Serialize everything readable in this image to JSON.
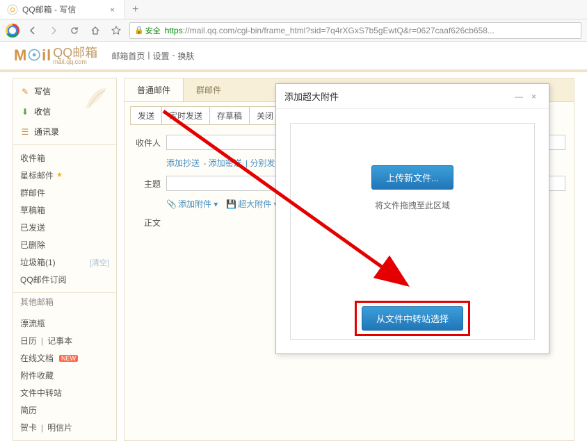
{
  "browser": {
    "tab_title": "QQ邮箱 - 写信",
    "secure_label": "安全",
    "url_https": "https",
    "url_rest": "://mail.qq.com/cgi-bin/frame_html?sid=7q4rXGxS7b5gEwtQ&r=0627caaf626cb658..."
  },
  "header": {
    "logo_m": "M",
    "logo_o": "☉",
    "logo_il": "il",
    "logo_cn": "QQ邮箱",
    "logo_url": "mail.qq.com",
    "links": {
      "home": "邮箱首页",
      "settings": "设置",
      "skin": "换肤"
    }
  },
  "sidebar": {
    "compose": [
      {
        "icon": "✎",
        "label": "写信"
      },
      {
        "icon": "⬇",
        "label": "收信"
      },
      {
        "icon": "☰",
        "label": "通讯录"
      }
    ],
    "folders": [
      {
        "label": "收件箱"
      },
      {
        "label": "星标邮件",
        "star": true
      },
      {
        "label": "群邮件"
      },
      {
        "label": "草稿箱"
      },
      {
        "label": "已发送"
      },
      {
        "label": "已删除"
      },
      {
        "label": "垃圾箱(1)",
        "clear": "[清空]"
      },
      {
        "label": "QQ邮件订阅"
      }
    ],
    "others_head": "其他邮箱",
    "others": [
      {
        "label": "漂流瓶"
      },
      {
        "label": "日历",
        "sep": "记事本"
      },
      {
        "label": "在线文档",
        "badge": "NEW"
      },
      {
        "label": "附件收藏"
      },
      {
        "label": "文件中转站"
      },
      {
        "label": "简历"
      },
      {
        "label": "贺卡",
        "sep": "明信片"
      }
    ]
  },
  "content": {
    "tabs": {
      "normal": "普通邮件",
      "group": "群邮件"
    },
    "actions": {
      "send": "发送",
      "timed": "定时发送",
      "draft": "存草稿",
      "close": "关闭"
    },
    "labels": {
      "to": "收件人",
      "subject": "主题",
      "body": "正文"
    },
    "extras": {
      "cc": "添加抄送",
      "bcc": "添加密送",
      "split": "分别发送"
    },
    "attach": {
      "normal": "添加附件",
      "big": "超大附件"
    }
  },
  "modal": {
    "title": "添加超大附件",
    "upload": "上传新文件...",
    "hint": "将文件拖拽至此区域",
    "relay": "从文件中转站选择"
  }
}
